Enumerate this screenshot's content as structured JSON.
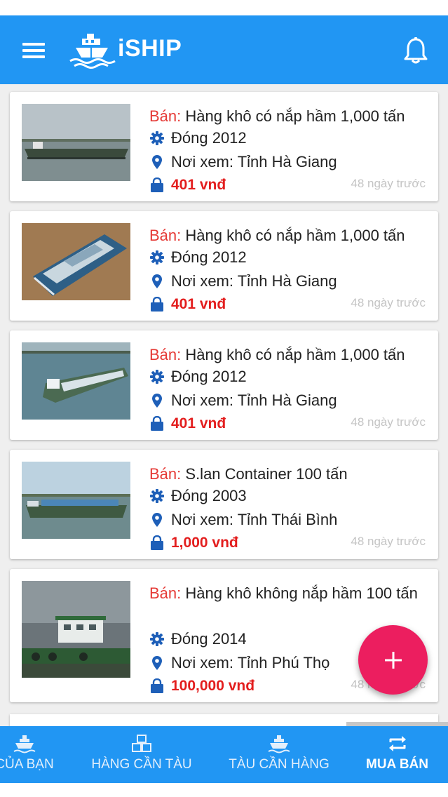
{
  "app": {
    "title": "iSHIP",
    "colors": {
      "primary": "#2196f3",
      "sell_label": "#e53935",
      "price": "#e31e1e",
      "fab": "#ec1e5f"
    },
    "icons": {
      "menu": "menu-icon",
      "logo": "ship-logo-icon",
      "notifications": "bell-icon"
    }
  },
  "listings": [
    {
      "sell_label": "Bán:",
      "title": "Hàng khô có nắp hầm 1,000 tấn",
      "built": "Đóng 2012",
      "location": "Nơi xem: Tỉnh Hà Giang",
      "price": "401 vnđ",
      "time": "48 ngày trước"
    },
    {
      "sell_label": "Bán:",
      "title": "Hàng khô có nắp hầm 1,000 tấn",
      "built": "Đóng 2012",
      "location": "Nơi xem: Tỉnh Hà Giang",
      "price": "401 vnđ",
      "time": "48 ngày trước"
    },
    {
      "sell_label": "Bán:",
      "title": "Hàng khô có nắp hầm 1,000 tấn",
      "built": "Đóng 2012",
      "location": "Nơi xem: Tỉnh Hà Giang",
      "price": "401 vnđ",
      "time": "48 ngày trước"
    },
    {
      "sell_label": "Bán:",
      "title": "S.lan Container 100 tấn",
      "built": "Đóng 2003",
      "location": "Nơi xem: Tỉnh Thái Bình",
      "price": "1,000 vnđ",
      "time": "48 ngày trước"
    },
    {
      "sell_label": "Bán:",
      "title": "Hàng khô không nắp hầm 100 tấn",
      "built": "Đóng 2014",
      "location": "Nơi xem: Tỉnh Phú Thọ",
      "price": "100,000 vnđ",
      "time": "48 ngày trước"
    }
  ],
  "fab": {
    "icon": "plus-icon"
  },
  "bottom_nav": [
    {
      "label": "CỦA BẠN",
      "icon": "ship-icon",
      "active": false
    },
    {
      "label": "HÀNG CẦN TÀU",
      "icon": "cargo-boxes-icon",
      "active": false
    },
    {
      "label": "TÀU CẦN HÀNG",
      "icon": "ship-icon",
      "active": false
    },
    {
      "label": "MUA BÁN",
      "icon": "exchange-icon",
      "active": true
    }
  ]
}
